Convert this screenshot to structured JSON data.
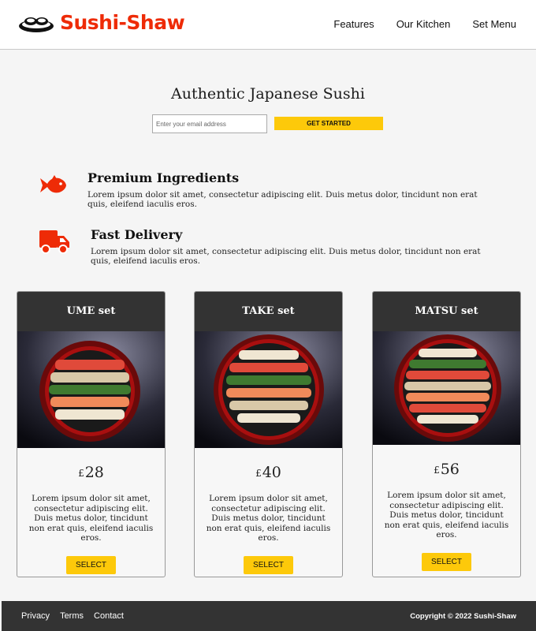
{
  "header": {
    "brand": "Sushi-Shaw",
    "nav": [
      "Features",
      "Our Kitchen",
      "Set Menu"
    ]
  },
  "hero": {
    "title": "Authentic Japanese Sushi",
    "email_placeholder": "Enter your email address",
    "cta_label": "GET STARTED"
  },
  "features": [
    {
      "icon": "fish-icon",
      "title": "Premium Ingredients",
      "text": "Lorem ipsum dolor sit amet, consectetur adipiscing elit. Duis metus dolor, tincidunt non erat quis, eleifend iaculis eros."
    },
    {
      "icon": "truck-icon",
      "title": "Fast Delivery",
      "text": "Lorem ipsum dolor sit amet, consectetur adipiscing elit. Duis metus dolor, tincidunt non erat quis, eleifend iaculis eros."
    }
  ],
  "menu": [
    {
      "name": "UME set",
      "currency": "£",
      "price": "28",
      "description": "Lorem ipsum dolor sit amet, consectetur adipiscing elit. Duis metus dolor, tincidunt non erat quis, eleifend iaculis eros.",
      "button": "SELECT"
    },
    {
      "name": "TAKE set",
      "currency": "£",
      "price": "40",
      "description": "Lorem ipsum dolor sit amet, consectetur adipiscing elit. Duis metus dolor, tincidunt non erat quis, eleifend iaculis eros.",
      "button": "SELECT"
    },
    {
      "name": "MATSU set",
      "currency": "£",
      "price": "56",
      "description": "Lorem ipsum dolor sit amet, consectetur adipiscing elit. Duis metus dolor, tincidunt non erat quis, eleifend iaculis eros.",
      "button": "SELECT"
    }
  ],
  "footer": {
    "links": [
      "Privacy",
      "Terms",
      "Contact"
    ],
    "copyright": "Copyright © 2022 Sushi-Shaw"
  },
  "colors": {
    "brand_red": "#ee2b07",
    "accent_yellow": "#fdc90a",
    "dark": "#333333"
  }
}
